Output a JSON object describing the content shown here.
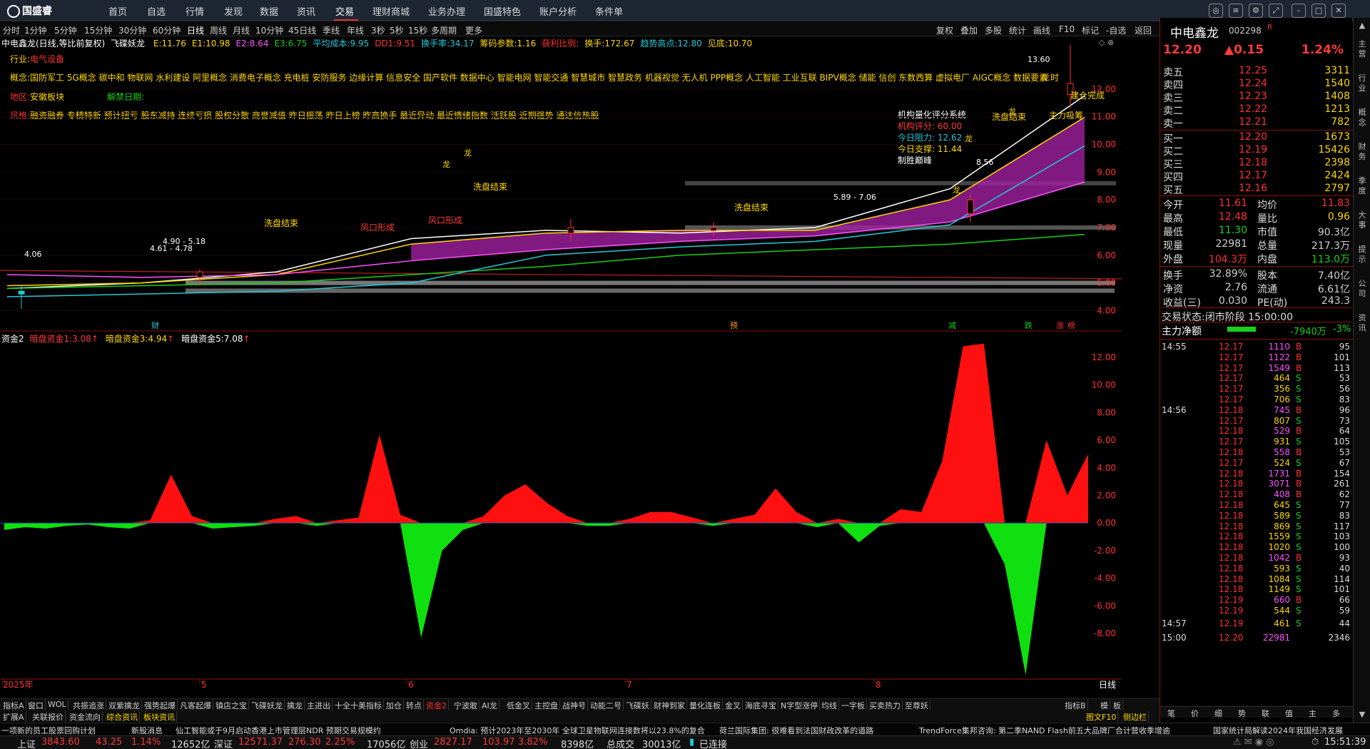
{
  "app": {
    "logo": "国盛睿"
  },
  "nav": [
    "首页",
    "自选",
    "行情",
    "发现",
    "数据",
    "资讯",
    "交易",
    "理财商城",
    "业务办理",
    "国盛特色",
    "账户分析",
    "条件单"
  ],
  "window_controls": [
    "消息",
    "菜单",
    "设置",
    "全屏",
    "最小化",
    "最大化",
    "关闭"
  ],
  "periods": [
    "分时",
    "1分钟",
    "5分钟",
    "15分钟",
    "30分钟",
    "60分钟",
    "日线",
    "周线",
    "月线",
    "10分钟",
    "45日线",
    "季线",
    "年线",
    "3秒",
    "5秒",
    "15秒",
    "多周期",
    "更多"
  ],
  "active_period": "日线",
  "right_tools": [
    "复权",
    "叠加",
    "多股",
    "统计",
    "画线",
    "F10",
    "标记",
    "-自选",
    "返回"
  ],
  "indicator_line": {
    "stock": "中电鑫龙(日线,等比前复权)",
    "name": "飞碟妖龙",
    "items": [
      {
        "k": "E:",
        "v": "11.76",
        "c": "#ffd700"
      },
      {
        "k": "E1:",
        "v": "10.98",
        "c": "#ffd700"
      },
      {
        "k": "E2:",
        "v": "8.64",
        "c": "#ff50ff"
      },
      {
        "k": "E3:",
        "v": "6.75",
        "c": "#18d018"
      },
      {
        "k": "平均成本:",
        "v": "9.95",
        "c": "#25c9d8"
      },
      {
        "k": "DD1:",
        "v": "9.51",
        "c": "#ff3030"
      },
      {
        "k": "换手率:",
        "v": "34.17",
        "c": "#25c9d8"
      },
      {
        "k": "筹码参数:",
        "v": "1.16",
        "c": "#ffd700"
      },
      {
        "k": "获利比例:",
        "v": "",
        "c": "#ff3030"
      },
      {
        "k": "换手:",
        "v": "172.67",
        "c": "#ffd700"
      },
      {
        "k": "趋势高点:",
        "v": "12.80",
        "c": "#25c9d8"
      },
      {
        "k": "见底:",
        "v": "10.70",
        "c": "#ffd700"
      }
    ]
  },
  "info": {
    "industry_label": "行业:",
    "industry": "电气设备",
    "concept_label": "概念:",
    "concepts": "国防军工 5G概念 碳中和 物联网 水利建设 阿里概念 消费电子概念 充电桩 安防服务 边缘计算 信息安全 国产软件 数据中心 智能电网 智能交通 智慧城市 智慧政务 机器视觉 无人机 PPP概念 人工智能 工业互联 BIPV概念 储能 信创 东数西算 虚拟电厂 AIGC概念 数据要素 时",
    "region_label": "地区:",
    "region": "安徽板块",
    "unban_label": "解禁日期:",
    "unban": "",
    "style_label": "风格:",
    "styles": "融资融券 专精特新 预计扭亏 股东减持 连续亏损 股权分散 商誉减值 昨日振荡 昨日上榜 昨高换手 最近异动 最近情绪指数 活跃股 近期强势 通达信热股"
  },
  "quant": {
    "title": "机构量化评分系统",
    "rows": [
      {
        "k": "机构评分:",
        "v": "60.00"
      },
      {
        "k": "今日阻力:",
        "v": "12.62"
      },
      {
        "k": "今日支撑:",
        "v": "11.44"
      }
    ],
    "slogan": "制胜巅峰"
  },
  "chart_data": [
    {
      "type": "line",
      "title": "中电鑫龙(日线,等比前复权)",
      "y_ticks": [
        "12.00",
        "11.00",
        "10.00",
        "9.00",
        "8.00",
        "7.00",
        "6.00",
        "5.00",
        "4.00"
      ],
      "ylim": [
        3.6,
        13.9
      ],
      "x_labels": [
        "2025年",
        "5",
        "6",
        "7",
        "8"
      ],
      "annotations": [
        "13.60",
        "4.06",
        "4.61 - 4.78",
        "4.90 - 5.18",
        "5.89 - 7.06",
        "8.56",
        "洗盘结束",
        "洗盘结束",
        "洗盘结束",
        "洗盘结束",
        "主力吸筹",
        "建仓完成",
        "风口形成",
        "风口形成",
        "龙"
      ],
      "event_markers": [
        "财",
        "预",
        "减",
        "跌",
        "涨",
        "榜"
      ],
      "candles": [
        {
          "date": "2025-04",
          "o": 4.7,
          "h": 4.9,
          "l": 4.06,
          "c": 4.6
        },
        {
          "date": "2025-05",
          "o": 5.2,
          "h": 5.5,
          "l": 4.9,
          "c": 5.4
        },
        {
          "date": "2025-06",
          "o": 6.8,
          "h": 7.3,
          "l": 6.5,
          "c": 7.0
        },
        {
          "date": "2025-07",
          "o": 6.9,
          "h": 7.2,
          "l": 6.7,
          "c": 7.0
        },
        {
          "date": "2025-08-early",
          "o": 7.5,
          "h": 8.2,
          "l": 7.2,
          "c": 8.0
        },
        {
          "date": "2025-08-late",
          "o": 11.8,
          "h": 13.6,
          "l": 11.3,
          "c": 12.2
        }
      ],
      "series": [
        {
          "name": "E",
          "values": [
            4.8,
            5.0,
            5.4,
            6.6,
            6.9,
            6.8,
            7.0,
            8.4,
            11.76
          ]
        },
        {
          "name": "E1",
          "values": [
            4.9,
            5.0,
            5.3,
            6.4,
            6.8,
            6.9,
            6.9,
            8.0,
            10.98
          ]
        },
        {
          "name": "E2",
          "values": [
            5.3,
            5.2,
            5.3,
            5.8,
            6.2,
            6.5,
            6.7,
            7.2,
            8.64
          ]
        },
        {
          "name": "E3",
          "values": [
            4.8,
            4.9,
            5.0,
            5.3,
            5.6,
            6.0,
            6.2,
            6.4,
            6.75
          ]
        },
        {
          "name": "平均成本",
          "values": [
            4.5,
            4.6,
            4.7,
            5.0,
            6.0,
            6.3,
            6.5,
            7.1,
            9.95
          ]
        }
      ]
    },
    {
      "type": "area",
      "title": "资金2",
      "series": [
        {
          "name": "暗盘资金1",
          "last": "3.08"
        },
        {
          "name": "暗盘资金3",
          "last": "4.94"
        },
        {
          "name": "暗盘资金5",
          "last": "7.08"
        }
      ],
      "y_ticks": [
        "12.00",
        "10.00",
        "8.00",
        "6.00",
        "4.00",
        "2.00",
        "0.00",
        "-2.00",
        "-4.00",
        "-6.00",
        "-8.00"
      ],
      "ylim": [
        -11.2,
        13.6
      ],
      "values": [
        -0.5,
        -0.3,
        -0.4,
        -0.2,
        -0.1,
        -0.3,
        -0.4,
        0.2,
        3.5,
        0.5,
        -0.4,
        -0.3,
        -0.2,
        0.3,
        0.5,
        -0.2,
        0.2,
        0.4,
        6.4,
        0.6,
        -8.3,
        -2.0,
        -0.5,
        0.5,
        2.0,
        2.8,
        1.5,
        0.5,
        -0.2,
        -0.2,
        0.3,
        0.8,
        0.8,
        0.4,
        -0.2,
        0.3,
        0.6,
        2.5,
        0.8,
        -0.3,
        0.3,
        -1.4,
        -0.2,
        1.0,
        0.8,
        4.5,
        12.8,
        13.0,
        -3.0,
        -11.0,
        6.0,
        2.0,
        5.0
      ]
    }
  ],
  "indicator2": {
    "label": "资金2",
    "items": [
      {
        "k": "暗盘资金1:",
        "v": "3.08"
      },
      {
        "k": "暗盘资金3:",
        "v": "4.94"
      },
      {
        "k": "暗盘资金5:",
        "v": "7.08"
      }
    ]
  },
  "quote": {
    "name": "中电鑫龙",
    "code": "002298",
    "mark": "R",
    "price": "12.20",
    "change": "0.15",
    "pct": "1.24%",
    "asks": [
      {
        "l": "卖五",
        "p": "12.25",
        "v": "3311"
      },
      {
        "l": "卖四",
        "p": "12.24",
        "v": "1540"
      },
      {
        "l": "卖三",
        "p": "12.23",
        "v": "1408"
      },
      {
        "l": "卖二",
        "p": "12.22",
        "v": "1213"
      },
      {
        "l": "卖一",
        "p": "12.21",
        "v": "782"
      }
    ],
    "bids": [
      {
        "l": "买一",
        "p": "12.20",
        "v": "1673"
      },
      {
        "l": "买二",
        "p": "12.19",
        "v": "15426"
      },
      {
        "l": "买三",
        "p": "12.18",
        "v": "2398"
      },
      {
        "l": "买四",
        "p": "12.17",
        "v": "2424"
      },
      {
        "l": "买五",
        "p": "12.16",
        "v": "2797"
      }
    ],
    "stats": [
      {
        "l1": "今开",
        "v1": "11.61",
        "l2": "均价",
        "v2": "11.83",
        "c1": "#ff3030",
        "c2": "#ff3030"
      },
      {
        "l1": "最高",
        "v1": "12.48",
        "l2": "量比",
        "v2": "0.96",
        "c1": "#ff3030",
        "c2": "#ffd700"
      },
      {
        "l1": "最低",
        "v1": "11.30",
        "l2": "市值",
        "v2": "90.3亿",
        "c1": "#18d018",
        "c2": "#d0d0d0"
      },
      {
        "l1": "现量",
        "v1": "22981",
        "l2": "总量",
        "v2": "217.3万",
        "c1": "#d0d0d0",
        "c2": "#d0d0d0"
      },
      {
        "l1": "外盘",
        "v1": "104.3万",
        "l2": "内盘",
        "v2": "113.0万",
        "c1": "#ff3030",
        "c2": "#18d018"
      },
      {
        "l1": "换手",
        "v1": "32.89%",
        "l2": "股本",
        "v2": "7.40亿",
        "c1": "#d0d0d0",
        "c2": "#d0d0d0"
      },
      {
        "l1": "净资",
        "v1": "2.76",
        "l2": "流通",
        "v2": "6.61亿",
        "c1": "#d0d0d0",
        "c2": "#d0d0d0"
      },
      {
        "l1": "收益(三)",
        "v1": "0.030",
        "l2": "PE(动)",
        "v2": "243.3",
        "c1": "#d0d0d0",
        "c2": "#d0d0d0"
      }
    ],
    "trade_status_label": "交易状态:",
    "trade_status": "闭市阶段 15:00:00",
    "net_label": "主力净额",
    "net_value": "-7940万",
    "net_pct": "-3%",
    "net_bar_fraction": 0.5
  },
  "ticks": [
    {
      "t": "14:55",
      "p": "12.17",
      "v": "1110",
      "s": "B",
      "n": "95"
    },
    {
      "t": "",
      "p": "12.17",
      "v": "1122",
      "s": "B",
      "n": "101"
    },
    {
      "t": "",
      "p": "12.17",
      "v": "1549",
      "s": "B",
      "n": "113"
    },
    {
      "t": "",
      "p": "12.17",
      "v": "464",
      "s": "S",
      "n": "53"
    },
    {
      "t": "",
      "p": "12.17",
      "v": "356",
      "s": "S",
      "n": "56"
    },
    {
      "t": "",
      "p": "12.17",
      "v": "706",
      "s": "S",
      "n": "83"
    },
    {
      "t": "14:56",
      "p": "12.18",
      "v": "745",
      "s": "B",
      "n": "96"
    },
    {
      "t": "",
      "p": "12.17",
      "v": "807",
      "s": "S",
      "n": "73"
    },
    {
      "t": "",
      "p": "12.18",
      "v": "529",
      "s": "B",
      "n": "64"
    },
    {
      "t": "",
      "p": "12.17",
      "v": "931",
      "s": "S",
      "n": "105"
    },
    {
      "t": "",
      "p": "12.18",
      "v": "558",
      "s": "B",
      "n": "53"
    },
    {
      "t": "",
      "p": "12.17",
      "v": "524",
      "s": "S",
      "n": "67"
    },
    {
      "t": "",
      "p": "12.18",
      "v": "1731",
      "s": "B",
      "n": "154"
    },
    {
      "t": "",
      "p": "12.18",
      "v": "3071",
      "s": "B",
      "n": "261"
    },
    {
      "t": "",
      "p": "12.18",
      "v": "408",
      "s": "B",
      "n": "62"
    },
    {
      "t": "",
      "p": "12.18",
      "v": "645",
      "s": "S",
      "n": "77"
    },
    {
      "t": "",
      "p": "12.18",
      "v": "589",
      "s": "S",
      "n": "83"
    },
    {
      "t": "",
      "p": "12.18",
      "v": "869",
      "s": "S",
      "n": "117"
    },
    {
      "t": "",
      "p": "12.18",
      "v": "1559",
      "s": "S",
      "n": "103"
    },
    {
      "t": "",
      "p": "12.18",
      "v": "1020",
      "s": "S",
      "n": "100"
    },
    {
      "t": "",
      "p": "12.18",
      "v": "1042",
      "s": "B",
      "n": "93"
    },
    {
      "t": "",
      "p": "12.18",
      "v": "593",
      "s": "S",
      "n": "40"
    },
    {
      "t": "",
      "p": "12.18",
      "v": "1084",
      "s": "S",
      "n": "114"
    },
    {
      "t": "",
      "p": "12.18",
      "v": "1149",
      "s": "S",
      "n": "101"
    },
    {
      "t": "",
      "p": "12.19",
      "v": "660",
      "s": "B",
      "n": "66"
    },
    {
      "t": "",
      "p": "12.19",
      "v": "544",
      "s": "S",
      "n": "59"
    },
    {
      "t": "14:57",
      "p": "12.19",
      "v": "461",
      "s": "S",
      "n": "44"
    },
    {
      "t": "15:00",
      "p": "12.20",
      "v": "22981",
      "s": "",
      "n": "2346"
    }
  ],
  "side_tabs": [
    "笔",
    "价",
    "细",
    "势",
    "联",
    "值",
    "主",
    "多"
  ],
  "vertical_tabs": [
    "主",
    "营",
    "行",
    "业",
    "概",
    "念",
    "财",
    "务",
    "季",
    "度",
    "大",
    "事",
    "提",
    "示",
    "公",
    "司",
    "资",
    "讯"
  ],
  "bottom_tabs": [
    "指标A",
    "窗口",
    "WOL",
    "共振追涨",
    "双紫擒龙",
    "强势起爆",
    "凡客起爆",
    "镇店之宝",
    "飞碟妖龙",
    "擒龙",
    "主进出",
    "十全十美指标",
    "加仓",
    "转点",
    "资金2",
    "宁波敢",
    "AI龙",
    "低金叉",
    "主控盘",
    "战神号",
    "动能二号",
    "飞碟妖",
    "财神到家",
    "量化连板",
    "金叉",
    "海底寻宝",
    "N字型涨停",
    "均线",
    "一字板",
    "买卖热力",
    "至尊妖"
  ],
  "active_bottom_tab": "资金2",
  "bottom_right": [
    "指标B",
    "模",
    "板"
  ],
  "bottom_tabs2": [
    "扩展A",
    "关联报价",
    "资金流向",
    "综合资讯",
    "板块资讯"
  ],
  "bottom_tabs2_right": [
    "图文F10",
    "侧边栏"
  ],
  "news": [
    "一项新的员工股票回购计划",
    "新股消息",
    "仙工智能或于9月启动香港上市管理层NDR 预期交易规模约",
    "Omdia: 预计2023年至2030年 全球卫星物联网连接数将以23.8%的复合",
    "荷兰国际集团: 很难看到法国财政改革的道路",
    "TrendForce集邦咨询: 第二季NAND Flash前五大品牌厂合计营收季增逾",
    "国家统计局解读2024年我国经济发展"
  ],
  "status": {
    "sh_label": "上证",
    "sh": "3843.60",
    "sh_chg": "43.25",
    "sh_pct": "1.14%",
    "sh_amt": "12652亿",
    "sz_label": "深证",
    "sz": "12571.37",
    "sz_chg": "276.30",
    "sz_pct": "2.25%",
    "sz_amt": "17056亿",
    "cy_label": "创业",
    "cy": "2827.17",
    "cy_chg": "103.97",
    "cy_pct": "3.82%",
    "cy_amt": "8398亿",
    "total_label": "总成交",
    "total": "30013亿",
    "conn": "已连接",
    "time": "15:51:39"
  },
  "colors": {
    "up": "#ff3030",
    "down": "#18d018",
    "accent": "#ffd700",
    "bg": "#000000",
    "axis": "#8a1010"
  }
}
